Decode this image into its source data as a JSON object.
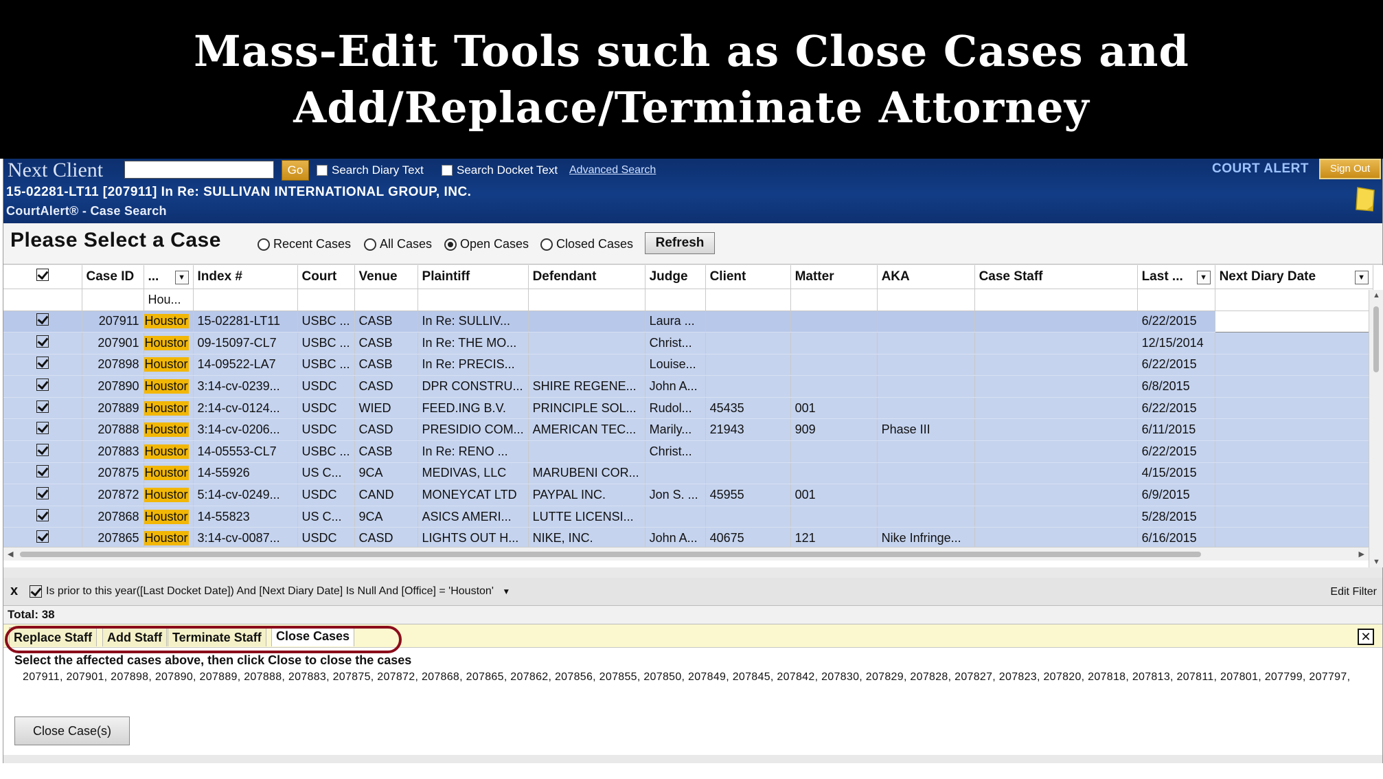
{
  "banner": {
    "line1": "Mass-Edit Tools such as Close Cases and",
    "line2": "Add/Replace/Terminate Attorney"
  },
  "header": {
    "next_client_label": "Next Client",
    "next_client_value": "",
    "go_label": "Go",
    "search_diary_label": "Search Diary Text",
    "search_docket_label": "Search Docket Text",
    "advanced_search_label": "Advanced Search",
    "brand": "COURT ALERT",
    "signout_label": "Sign Out",
    "case_line": "15-02281-LT11 [207911] In Re: SULLIVAN INTERNATIONAL GROUP, INC.",
    "crumb": "CourtAlert® - Case Search",
    "note_icon": "sticky-note-icon"
  },
  "select_bar": {
    "title": "Please Select a Case",
    "radios": [
      "Recent Cases",
      "All Cases",
      "Open Cases",
      "Closed Cases"
    ],
    "selected": "Open Cases",
    "refresh_label": "Refresh"
  },
  "grid": {
    "columns": [
      "",
      "Case ID",
      "...",
      "Index #",
      "Court",
      "Venue",
      "Plaintiff",
      "Defendant",
      "Judge",
      "Client",
      "Matter",
      "AKA",
      "Case Staff",
      "Last ...",
      "Next Diary Date"
    ],
    "filter_office": "Hou...",
    "rows": [
      {
        "id": "207911",
        "office": "Houstor",
        "index": "15-02281-LT11",
        "court": "USBC ...",
        "venue": "CASB",
        "plaintiff": "In Re: SULLIV...",
        "defendant": "",
        "judge": "Laura ...",
        "client": "",
        "matter": "",
        "aka": "",
        "staff": "",
        "last": "6/22/2015",
        "next": ""
      },
      {
        "id": "207901",
        "office": "Houstor",
        "index": "09-15097-CL7",
        "court": "USBC ...",
        "venue": "CASB",
        "plaintiff": "In Re: THE MO...",
        "defendant": "",
        "judge": "Christ...",
        "client": "",
        "matter": "",
        "aka": "",
        "staff": "",
        "last": "12/15/2014",
        "next": ""
      },
      {
        "id": "207898",
        "office": "Houstor",
        "index": "14-09522-LA7",
        "court": "USBC ...",
        "venue": "CASB",
        "plaintiff": "In Re: PRECIS...",
        "defendant": "",
        "judge": "Louise...",
        "client": "",
        "matter": "",
        "aka": "",
        "staff": "",
        "last": "6/22/2015",
        "next": ""
      },
      {
        "id": "207890",
        "office": "Houstor",
        "index": "3:14-cv-0239...",
        "court": "USDC",
        "venue": "CASD",
        "plaintiff": "DPR CONSTRU...",
        "defendant": "SHIRE REGENE...",
        "judge": "John A...",
        "client": "",
        "matter": "",
        "aka": "",
        "staff": "",
        "last": "6/8/2015",
        "next": ""
      },
      {
        "id": "207889",
        "office": "Houstor",
        "index": "2:14-cv-0124...",
        "court": "USDC",
        "venue": "WIED",
        "plaintiff": "FEED.ING B.V.",
        "defendant": "PRINCIPLE SOL...",
        "judge": "Rudol...",
        "client": "45435",
        "matter": "001",
        "aka": "",
        "staff": "",
        "last": "6/22/2015",
        "next": ""
      },
      {
        "id": "207888",
        "office": "Houstor",
        "index": "3:14-cv-0206...",
        "court": "USDC",
        "venue": "CASD",
        "plaintiff": "PRESIDIO COM...",
        "defendant": "AMERICAN TEC...",
        "judge": "Marily...",
        "client": "21943",
        "matter": "909",
        "aka": "Phase III",
        "staff": "",
        "last": "6/11/2015",
        "next": ""
      },
      {
        "id": "207883",
        "office": "Houstor",
        "index": "14-05553-CL7",
        "court": "USBC ...",
        "venue": "CASB",
        "plaintiff": "In Re: RENO ...",
        "defendant": "",
        "judge": "Christ...",
        "client": "",
        "matter": "",
        "aka": "",
        "staff": "",
        "last": "6/22/2015",
        "next": ""
      },
      {
        "id": "207875",
        "office": "Houstor",
        "index": "14-55926",
        "court": "US C...",
        "venue": "9CA",
        "plaintiff": "MEDIVAS, LLC",
        "defendant": "MARUBENI COR...",
        "judge": "",
        "client": "",
        "matter": "",
        "aka": "",
        "staff": "",
        "last": "4/15/2015",
        "next": ""
      },
      {
        "id": "207872",
        "office": "Houstor",
        "index": "5:14-cv-0249...",
        "court": "USDC",
        "venue": "CAND",
        "plaintiff": "MONEYCAT LTD",
        "defendant": "PAYPAL INC.",
        "judge": "Jon S. ...",
        "client": "45955",
        "matter": "001",
        "aka": "",
        "staff": "",
        "last": "6/9/2015",
        "next": ""
      },
      {
        "id": "207868",
        "office": "Houstor",
        "index": "14-55823",
        "court": "US C...",
        "venue": "9CA",
        "plaintiff": "ASICS AMERI...",
        "defendant": "LUTTE LICENSI...",
        "judge": "",
        "client": "",
        "matter": "",
        "aka": "",
        "staff": "",
        "last": "5/28/2015",
        "next": ""
      },
      {
        "id": "207865",
        "office": "Houstor",
        "index": "3:14-cv-0087...",
        "court": "USDC",
        "venue": "CASD",
        "plaintiff": "LIGHTS OUT H...",
        "defendant": "NIKE, INC.",
        "judge": "John A...",
        "client": "40675",
        "matter": "121",
        "aka": "Nike Infringe...",
        "staff": "",
        "last": "6/16/2015",
        "next": ""
      }
    ]
  },
  "filter_bar": {
    "close_label": "x",
    "expression": "Is prior to this year([Last Docket Date]) And [Next Diary Date] Is Null And [Office] = 'Houston'",
    "edit_label": "Edit Filter"
  },
  "total": "Total: 38",
  "tabs": [
    "Replace Staff",
    "Add Staff",
    "Terminate Staff",
    "Close Cases"
  ],
  "active_tab": "Close Cases",
  "close_panel": {
    "instruction": "Select the affected cases above, then click Close to close the cases",
    "ids": "207911, 207901, 207898, 207890, 207889, 207888, 207883, 207875, 207872, 207868, 207865, 207862, 207856, 207855, 207850, 207849, 207845, 207842, 207830, 207829, 207828, 207827, 207823, 207820, 207818, 207813, 207811, 207801, 207799, 207797,",
    "button_label": "Close Case(s)"
  },
  "colors": {
    "header_blue": "#123d86",
    "office_highlight": "#f2b705",
    "row_selected": "#c5d3ee",
    "oval": "#8b0d1b"
  }
}
